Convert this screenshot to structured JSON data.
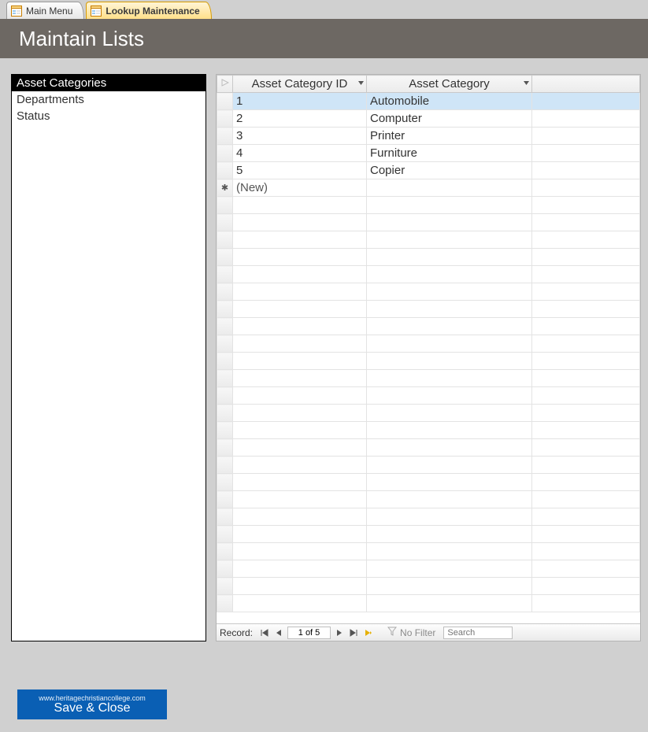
{
  "tabs": [
    {
      "label": "Main Menu",
      "active": false
    },
    {
      "label": "Lookup Maintenance",
      "active": true
    }
  ],
  "banner": {
    "title": "Maintain Lists"
  },
  "sidebar": {
    "items": [
      {
        "label": "Asset Categories",
        "selected": true
      },
      {
        "label": "Departments",
        "selected": false
      },
      {
        "label": "Status",
        "selected": false
      }
    ]
  },
  "grid": {
    "columns": [
      {
        "label": "Asset Category ID"
      },
      {
        "label": "Asset Category"
      }
    ],
    "rows": [
      {
        "id": "1",
        "cat": "Automobile",
        "selected": true
      },
      {
        "id": "2",
        "cat": "Computer",
        "selected": false
      },
      {
        "id": "3",
        "cat": "Printer",
        "selected": false
      },
      {
        "id": "4",
        "cat": "Furniture",
        "selected": false
      },
      {
        "id": "5",
        "cat": "Copier",
        "selected": false
      }
    ],
    "new_row_label": "(New)"
  },
  "recnav": {
    "label": "Record:",
    "position": "1 of 5",
    "filter": "No Filter",
    "search_placeholder": "Search"
  },
  "save_button": {
    "small": "www.heritagechristiancollege.com",
    "label": "Save & Close"
  }
}
